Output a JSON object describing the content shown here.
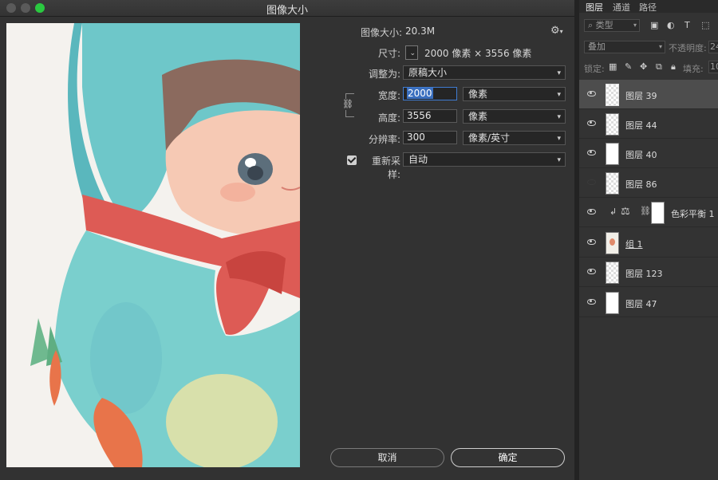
{
  "dialog": {
    "title": "图像大小",
    "image_size_label": "图像大小:",
    "image_size_value": "20.3M",
    "dimensions_label": "尺寸:",
    "dimensions_value": "2000 像素  ×  3556 像素",
    "fit_to_label": "调整为:",
    "fit_to_value": "原稿大小",
    "width_label": "宽度:",
    "width_value": "2000",
    "width_unit": "像素",
    "height_label": "高度:",
    "height_value": "3556",
    "height_unit": "像素",
    "resolution_label": "分辨率:",
    "resolution_value": "300",
    "resolution_unit": "像素/英寸",
    "resample_label": "重新采样:",
    "resample_checked": true,
    "resample_value": "自动",
    "cancel_label": "取消",
    "ok_label": "确定"
  },
  "panel": {
    "tabs": [
      "图层",
      "通道",
      "路径"
    ],
    "kind_filter": "类型",
    "blend_mode": "叠加",
    "opacity_label": "不透明度:",
    "opacity_value": "24",
    "lock_label": "锁定:",
    "fill_label": "填充:",
    "fill_value": "10",
    "layers": [
      {
        "name": "图层 39",
        "visible": true,
        "selected": true,
        "thumb": "transparent"
      },
      {
        "name": "图层 44",
        "visible": true,
        "selected": false,
        "thumb": "transparent"
      },
      {
        "name": "图层 40",
        "visible": true,
        "selected": false,
        "thumb": "white"
      },
      {
        "name": "图层 86",
        "visible": false,
        "selected": false,
        "thumb": "transparent"
      },
      {
        "name": "色彩平衡 1",
        "visible": true,
        "selected": false,
        "thumb": "adjustment"
      },
      {
        "name": "组 1",
        "visible": true,
        "selected": false,
        "thumb": "group"
      },
      {
        "name": "图层 123",
        "visible": true,
        "selected": false,
        "thumb": "transparent"
      },
      {
        "name": "图层 47",
        "visible": true,
        "selected": false,
        "thumb": "white"
      }
    ]
  }
}
